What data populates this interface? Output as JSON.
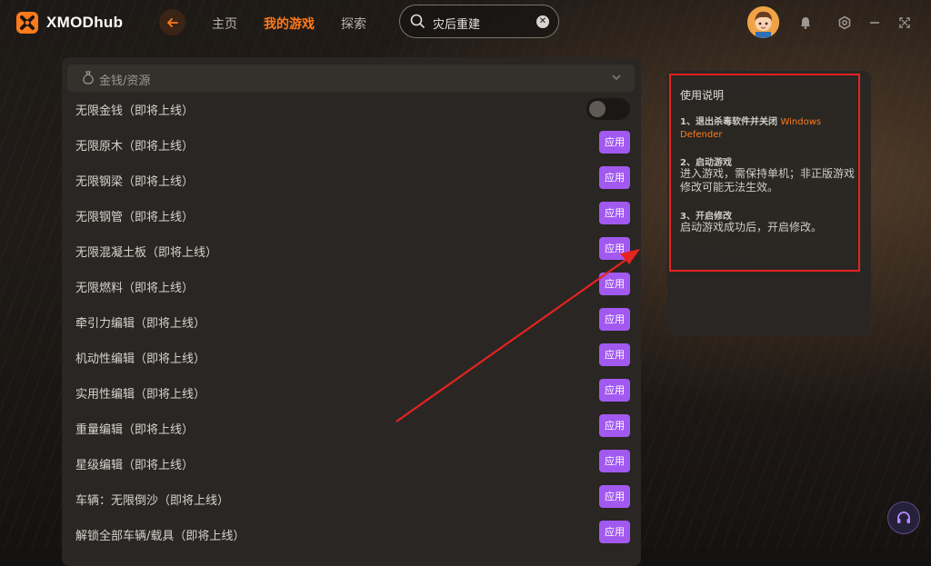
{
  "header": {
    "logo_prefix": "XMOD",
    "logo_suffix": "hub",
    "nav": [
      "主页",
      "我的游戏",
      "探索"
    ],
    "search_value": "灾后重建"
  },
  "section": {
    "title": "金钱/资源"
  },
  "rows": [
    {
      "label": "无限金钱（即将上线）",
      "control": "toggle"
    },
    {
      "label": "无限原木（即将上线）",
      "control": "应用"
    },
    {
      "label": "无限钢梁（即将上线）",
      "control": "应用"
    },
    {
      "label": "无限钢管（即将上线）",
      "control": "应用"
    },
    {
      "label": "无限混凝土板（即将上线）",
      "control": "应用"
    },
    {
      "label": "无限燃料（即将上线）",
      "control": "应用"
    },
    {
      "label": "牵引力编辑（即将上线）",
      "control": "应用"
    },
    {
      "label": "机动性编辑（即将上线）",
      "control": "应用"
    },
    {
      "label": "实用性编辑（即将上线）",
      "control": "应用"
    },
    {
      "label": "重量编辑（即将上线）",
      "control": "应用"
    },
    {
      "label": "星级编辑（即将上线）",
      "control": "应用"
    },
    {
      "label": "车辆：无限倒沙（即将上线）",
      "control": "应用"
    },
    {
      "label": "解锁全部车辆/载具（即将上线）",
      "control": "应用"
    }
  ],
  "instructions": {
    "title": "使用说明",
    "step1_title": "1、退出杀毒软件并关闭",
    "step1_highlight": "Windows Defender",
    "step2_title": "2、启动游戏",
    "step2_body": "进入游戏，需保持单机；非正版游戏修改可能无法生效。",
    "step3_title": "3、开启修改",
    "step3_body": "启动游戏成功后，开启修改。"
  },
  "colors": {
    "accent": "#ff7a1a",
    "apply_button": "#a259f0",
    "annotation_red": "#e52320"
  }
}
